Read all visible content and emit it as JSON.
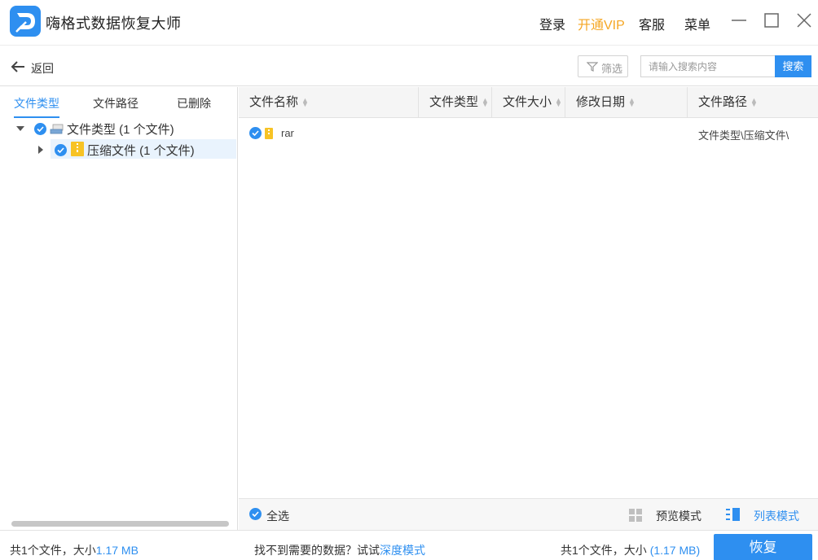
{
  "app": {
    "title": "嗨格式数据恢复大师"
  },
  "topnav": {
    "login": "登录",
    "vip": "开通VIP",
    "service": "客服",
    "menu": "菜单"
  },
  "toolbar": {
    "back_label": "返回",
    "filter_label": "筛选",
    "search_placeholder": "请输入搜索内容",
    "search_button": "搜索"
  },
  "left_tabs": [
    "文件类型",
    "文件路径",
    "已删除"
  ],
  "tree": [
    {
      "label": "文件类型 (1 个文件)",
      "checked": true,
      "expanded": true
    },
    {
      "label": "压缩文件 (1 个文件)",
      "checked": true,
      "expanded": false,
      "selected": true
    }
  ],
  "columns": [
    "文件名称",
    "文件类型",
    "文件大小",
    "修改日期",
    "文件路径"
  ],
  "rows": [
    {
      "name": "rar",
      "type": "",
      "size": "",
      "date": "",
      "path": "文件类型\\压缩文件\\",
      "checked": true
    }
  ],
  "bottom": {
    "select_all": "全选",
    "preview_mode": "预览模式",
    "list_mode": "列表模式"
  },
  "status": {
    "left_prefix": "共1个文件，大小",
    "left_size": "1.17 MB",
    "hint": "找不到需要的数据？试试",
    "hint_link": "深度模式",
    "right_prefix": "共1个文件，大小",
    "right_size": "(1.17 MB)",
    "recover": "恢复"
  },
  "colors": {
    "accent": "#2e8ff0",
    "vip": "#f5a623"
  }
}
